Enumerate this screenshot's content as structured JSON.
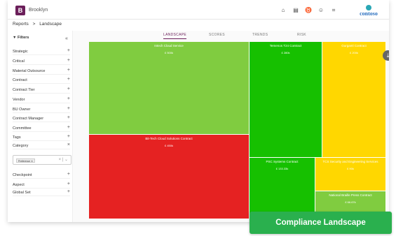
{
  "app": {
    "brand": "Brooklyn",
    "logo_letter": "B",
    "org": "contoso"
  },
  "breadcrumb": {
    "root": "Reports",
    "sep": ">",
    "current": "Landscape"
  },
  "sidebar": {
    "title": "Filters",
    "collapse_glyph": "«",
    "items": [
      {
        "label": "Strategic",
        "ctl": "+"
      },
      {
        "label": "Critical",
        "ctl": "+"
      },
      {
        "label": "Material Outsource",
        "ctl": "+"
      },
      {
        "label": "Contract",
        "ctl": "+"
      },
      {
        "label": "Contract Tier",
        "ctl": "+"
      },
      {
        "label": "Vendor",
        "ctl": "+"
      },
      {
        "label": "BU Owner",
        "ctl": "+"
      },
      {
        "label": "Contract Manager",
        "ctl": "+"
      },
      {
        "label": "Committee",
        "ctl": "+"
      },
      {
        "label": "Tags",
        "ctl": "+"
      },
      {
        "label": "Category",
        "ctl": "×"
      }
    ],
    "category_chip": "Preference",
    "more_items": [
      {
        "label": "Checkpoint",
        "ctl": "+"
      },
      {
        "label": "Aspect",
        "ctl": "+"
      },
      {
        "label": "Global Set",
        "ctl": "+"
      }
    ]
  },
  "tabs": [
    {
      "label": "LANDSCAPE",
      "active": true
    },
    {
      "label": "SCORES",
      "active": false
    },
    {
      "label": "TRENDS",
      "active": false
    },
    {
      "label": "RISK",
      "active": false
    }
  ],
  "treemap": [
    {
      "name": "Intech Cloud Service",
      "value": "£ 500k",
      "color": "#80cc40"
    },
    {
      "name": "Bit-Tech Cloud Solutions Contract",
      "value": "£ 450k",
      "color": "#e52222"
    },
    {
      "name": "Temenos T24 Contract",
      "value": "£ 280k",
      "color": "#16c000"
    },
    {
      "name": "Gurgaml Contract",
      "value": "£ 200k",
      "color": "#ffd700"
    },
    {
      "name": "PSC Systems Contract",
      "value": "£ 133.33k",
      "color": "#16c000"
    },
    {
      "name": "TCS Security and Engineering Services",
      "value": "£ 90k",
      "color": "#ffd700"
    },
    {
      "name": "National Braille Press Contract",
      "value": "£ 66.67k",
      "color": "#80cc40"
    }
  ],
  "badge": "Compliance Landscape"
}
